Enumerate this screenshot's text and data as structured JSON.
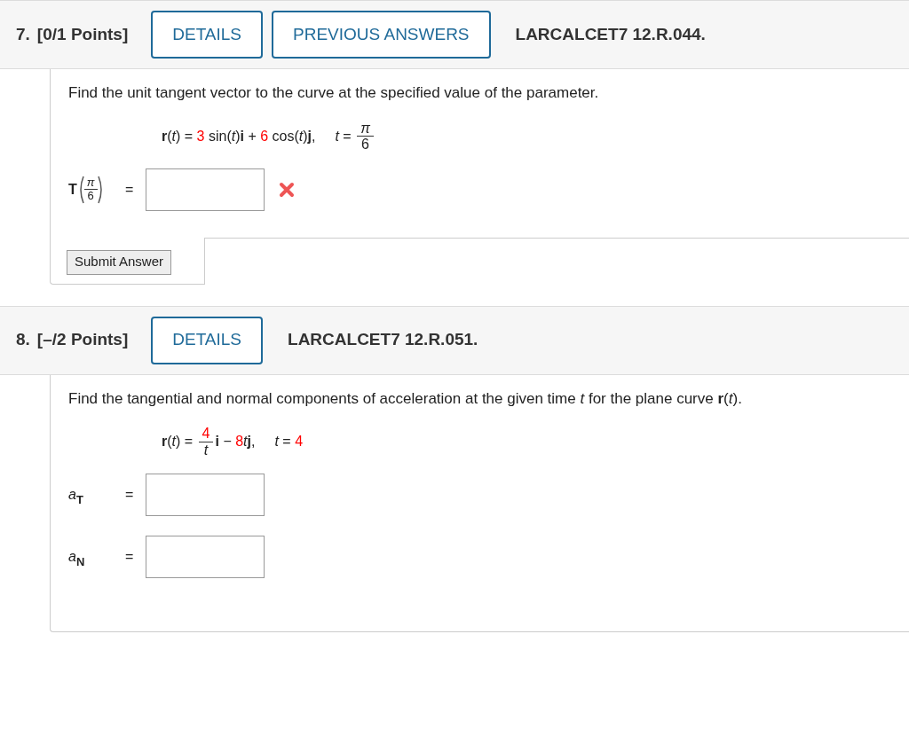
{
  "questions": [
    {
      "number": "7.",
      "points": "[0/1 Points]",
      "buttons": [
        "DETAILS",
        "PREVIOUS ANSWERS"
      ],
      "code": "LARCALCET7 12.R.044.",
      "prompt": "Find the unit tangent vector to the curve at the specified value of the parameter.",
      "equation": [
        {
          "kind": "text",
          "text": "**r**(*t*) = "
        },
        {
          "kind": "given",
          "text": "3"
        },
        {
          "kind": "text",
          "text": " sin(*t*)**i** + "
        },
        {
          "kind": "given",
          "text": "6"
        },
        {
          "kind": "text",
          "text": " cos(*t*)**j**,"
        },
        {
          "kind": "space"
        },
        {
          "kind": "text",
          "text": "*t* = "
        },
        {
          "kind": "fraction",
          "num": "*π*",
          "den": "6"
        }
      ],
      "answers": [
        {
          "label": [
            {
              "kind": "text",
              "text": "**T**"
            },
            {
              "kind": "paren_fraction",
              "num": "*π*",
              "den": "6"
            }
          ],
          "equals": "=",
          "incorrect": true
        }
      ],
      "submit": "Submit Answer"
    },
    {
      "number": "8.",
      "points": "[–/2 Points]",
      "buttons": [
        "DETAILS"
      ],
      "code": "LARCALCET7 12.R.051.",
      "prompt": "Find the tangential and normal components of acceleration at the given time *t* for the plane curve **r**(*t*).",
      "equation": [
        {
          "kind": "text",
          "text": "**r**(*t*) = "
        },
        {
          "kind": "given_fraction",
          "num": "4",
          "den": "*t*"
        },
        {
          "kind": "text",
          "text": "**i** − "
        },
        {
          "kind": "given",
          "text": "8"
        },
        {
          "kind": "text",
          "text": "*t*"
        },
        {
          "kind": "text",
          "text": "**j**,"
        },
        {
          "kind": "space"
        },
        {
          "kind": "text",
          "text": "*t* = "
        },
        {
          "kind": "given",
          "text": "4"
        }
      ],
      "answers": [
        {
          "label": [
            {
              "kind": "text",
              "text": "*a*"
            },
            {
              "kind": "sub",
              "text": "T"
            }
          ],
          "equals": "=",
          "incorrect": false
        },
        {
          "label": [
            {
              "kind": "text",
              "text": "*a*"
            },
            {
              "kind": "sub",
              "text": "N"
            }
          ],
          "equals": "=",
          "incorrect": false
        }
      ]
    }
  ]
}
